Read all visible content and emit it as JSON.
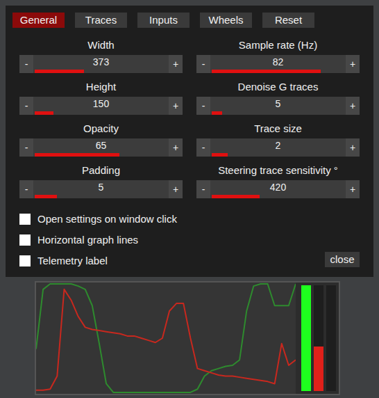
{
  "tabs": [
    {
      "label": "General",
      "selected": true
    },
    {
      "label": "Traces",
      "selected": false
    },
    {
      "label": "Inputs",
      "selected": false
    },
    {
      "label": "Wheels",
      "selected": false
    },
    {
      "label": "Reset",
      "selected": false
    }
  ],
  "settings": [
    {
      "label": "Width",
      "value": "373",
      "level": 0.37
    },
    {
      "label": "Sample rate (Hz)",
      "value": "82",
      "level": 0.82
    },
    {
      "label": "Height",
      "value": "150",
      "level": 0.14
    },
    {
      "label": "Denoise G traces",
      "value": "5",
      "level": 0.08
    },
    {
      "label": "Opacity",
      "value": "65",
      "level": 0.64
    },
    {
      "label": "Trace size",
      "value": "2",
      "level": 0.12
    },
    {
      "label": "Padding",
      "value": "5",
      "level": 0.17
    },
    {
      "label": "Steering trace sensitivity °",
      "value": "420",
      "level": 0.36
    }
  ],
  "stepper": {
    "decrement": "-",
    "increment": "+"
  },
  "checkboxes": [
    {
      "label": "Open settings on window click",
      "checked": false
    },
    {
      "label": "Horizontal graph lines",
      "checked": false
    },
    {
      "label": "Telemetry label",
      "checked": false
    }
  ],
  "close_button": "close",
  "telemetry": {
    "traces": [
      {
        "color": "#2e8b2e",
        "values": [
          40,
          95,
          100,
          100,
          100,
          100,
          98,
          95,
          80,
          45,
          8,
          0,
          0,
          0,
          0,
          0,
          0,
          0,
          0,
          0,
          0,
          0,
          0,
          3,
          15,
          20,
          22,
          24,
          25,
          30,
          75,
          98,
          100,
          100,
          80,
          80,
          80,
          100
        ]
      },
      {
        "color": "#c8281e",
        "values": [
          2,
          2,
          3,
          15,
          95,
          85,
          70,
          60,
          58,
          57,
          56,
          55,
          54,
          52,
          52,
          50,
          48,
          46,
          50,
          75,
          82,
          82,
          50,
          22,
          20,
          18,
          16,
          15,
          15,
          14,
          13,
          12,
          11,
          10,
          8,
          45,
          25,
          30
        ]
      }
    ],
    "bars": [
      {
        "level": 1.0,
        "color": "#1eff1e"
      },
      {
        "level": 0.42,
        "color": "#e0201a"
      },
      {
        "level": 0,
        "color": "#4a90d9"
      }
    ]
  }
}
